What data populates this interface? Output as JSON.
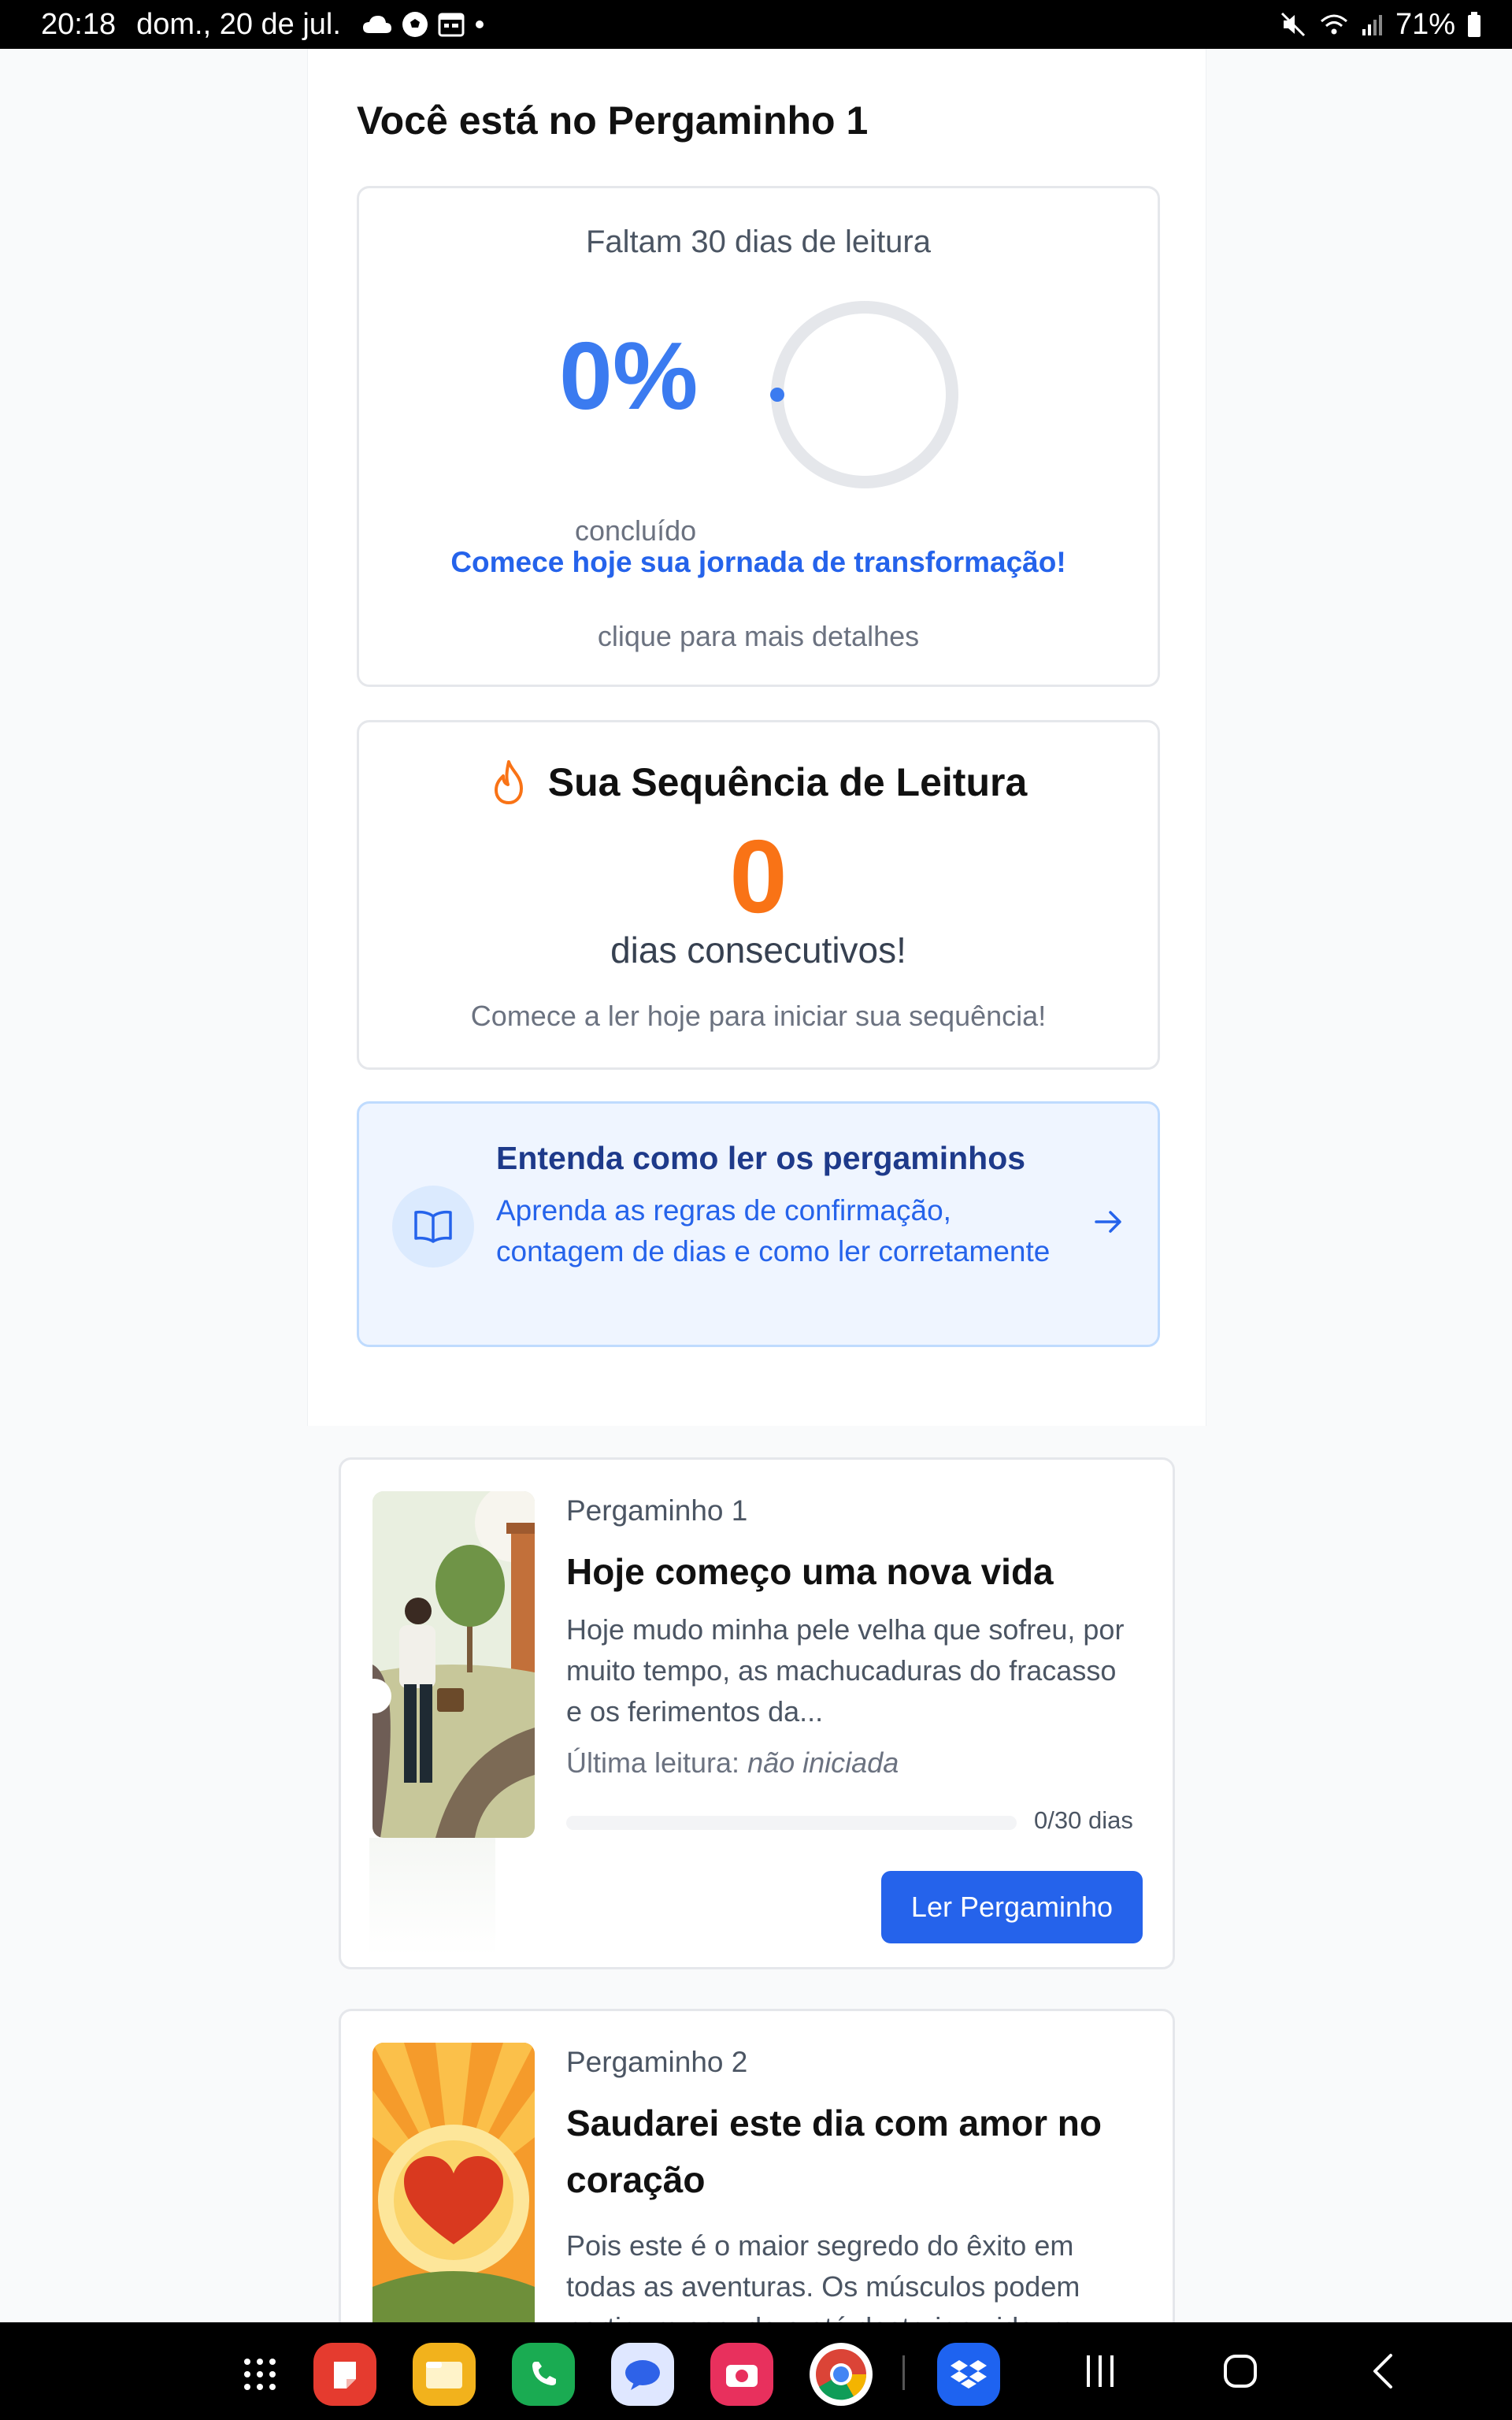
{
  "status_bar": {
    "time": "20:18",
    "date": "dom., 20 de jul.",
    "battery": "71%",
    "left_icons": [
      "cloud-icon",
      "soccer-ball-icon",
      "calendar-icon",
      "dot-icon"
    ],
    "right_icons": [
      "mute-icon",
      "wifi-icon",
      "signal-icon",
      "battery-icon"
    ]
  },
  "header": {
    "title": "Você está no Pergaminho 1"
  },
  "progress": {
    "remaining": "Faltam 30 dias de leitura",
    "percent": "0%",
    "percent_value": 0,
    "done_label": "concluído",
    "cta": "Comece hoje sua jornada de transformação!",
    "hint": "clique para mais detalhes",
    "ring_color": "#3b7bf0"
  },
  "streak": {
    "title": "Sua Sequência de Leitura",
    "count": "0",
    "subtitle": "dias consecutivos!",
    "hint": "Comece a ler hoje para iniciar sua sequência!",
    "icon": "flame-icon",
    "color": "#f97316"
  },
  "guide": {
    "title": "Entenda como ler os pergaminhos",
    "description": "Aprenda as regras de confirmação, contagem de dias e como ler corretamente",
    "icon": "book-open-icon",
    "arrow_icon": "arrow-right-icon"
  },
  "scrolls": [
    {
      "number": "Pergaminho 1",
      "title": "Hoje começo uma nova vida",
      "excerpt": "Hoje mudo minha pele velha que sofreu, por muito tempo, as machucaduras do fracasso e os ferimentos da...",
      "last_read_label": "Última leitura:",
      "last_read_value": "não iniciada",
      "days_label": "0/30 dias",
      "days_progress": 0,
      "button": "Ler Pergaminho"
    },
    {
      "number": "Pergaminho 2",
      "title": "Saudarei este dia com amor no coração",
      "excerpt": "Pois este é o maior segredo do êxito em todas as aventuras. Os músculos podem partir um escudo e até destruir a vida, m..."
    }
  ],
  "nav": {
    "apps": [
      "apps-grid-icon",
      "notes-app-icon",
      "files-app-icon",
      "phone-app-icon",
      "messages-app-icon",
      "camera-app-icon",
      "chrome-app-icon",
      "dropbox-app-icon"
    ],
    "system": [
      "recents-button",
      "home-button",
      "back-button"
    ]
  }
}
